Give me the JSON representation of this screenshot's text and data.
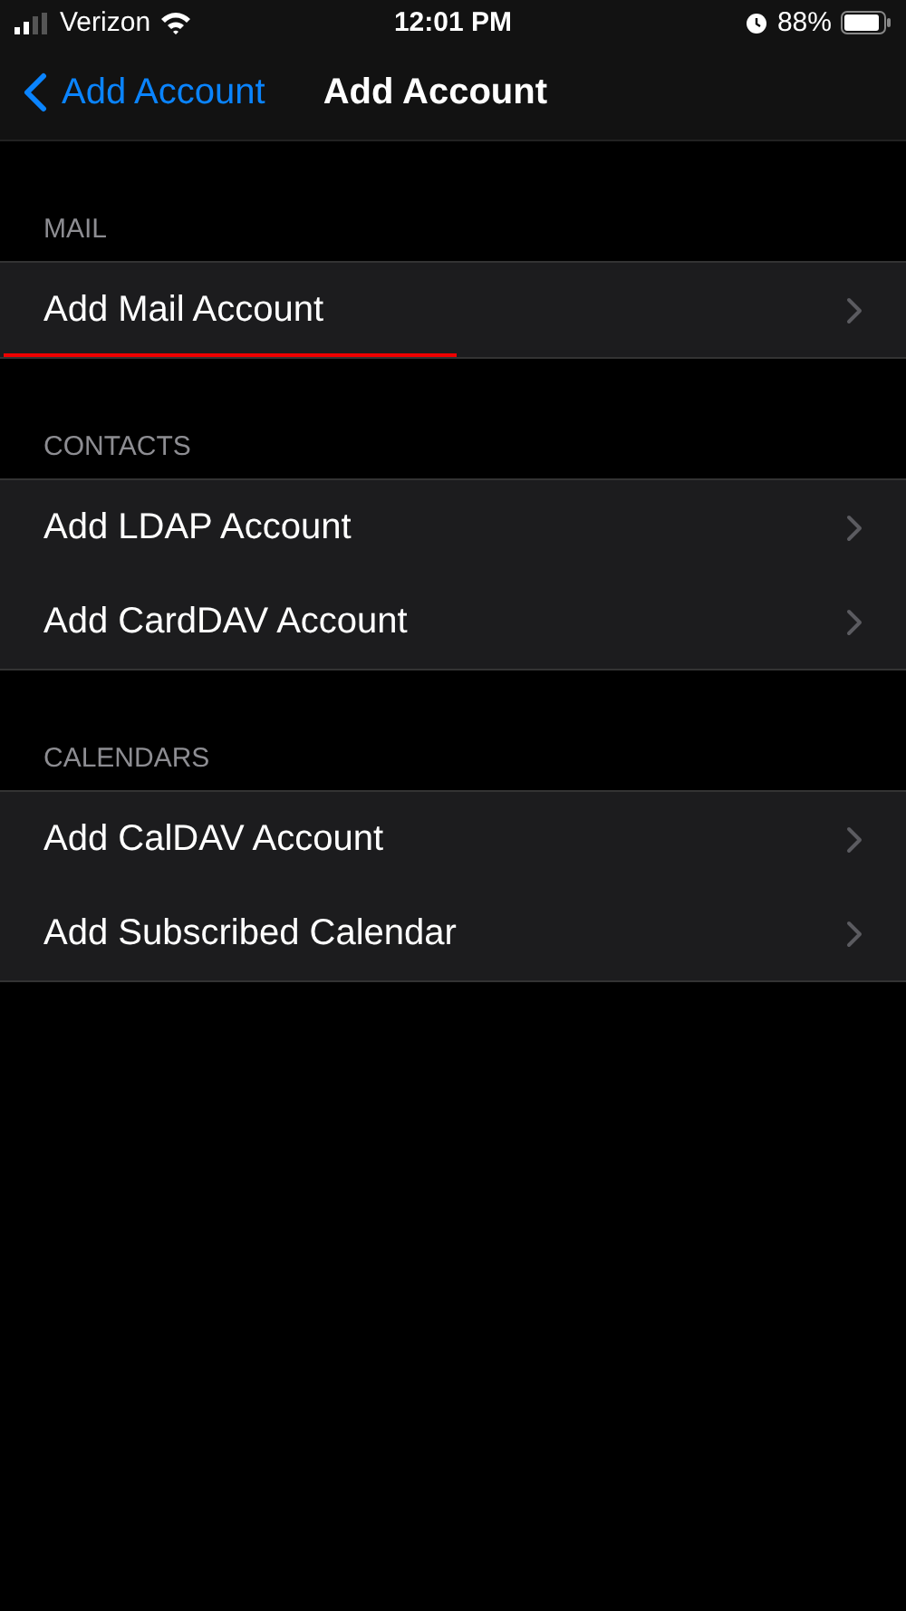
{
  "status_bar": {
    "carrier": "Verizon",
    "time": "12:01 PM",
    "battery": "88%"
  },
  "nav_bar": {
    "back": "Add Account",
    "title": "Add Account"
  },
  "sections": [
    {
      "header": "MAIL",
      "items": [
        {
          "label": "Add Mail Account",
          "highlighted": true
        }
      ]
    },
    {
      "header": "CONTACTS",
      "items": [
        {
          "label": "Add LDAP Account",
          "highlighted": false
        },
        {
          "label": "Add CardDAV Account",
          "highlighted": false
        }
      ]
    },
    {
      "header": "CALENDARS",
      "items": [
        {
          "label": "Add CalDAV Account",
          "highlighted": false
        },
        {
          "label": "Add Subscribed Calendar",
          "highlighted": false
        }
      ]
    }
  ]
}
